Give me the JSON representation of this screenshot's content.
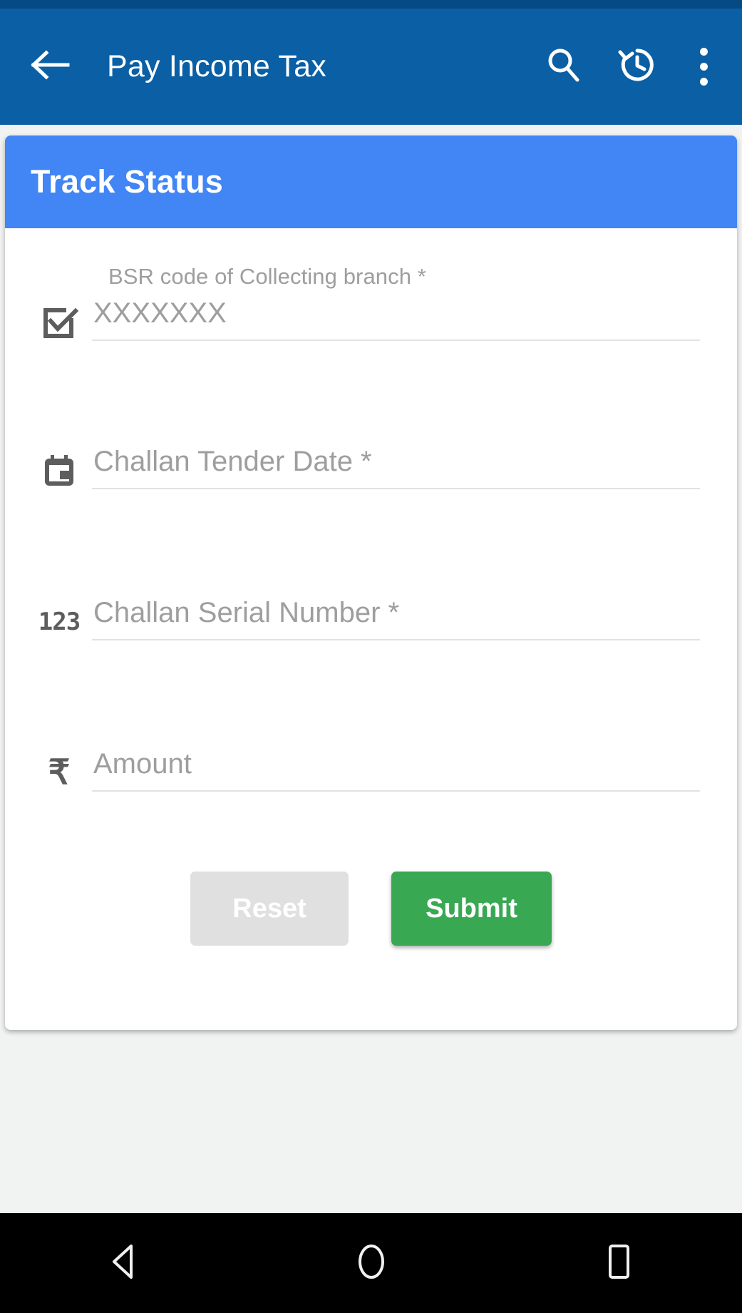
{
  "appbar": {
    "title": "Pay Income Tax",
    "back_icon": "arrow-left-icon",
    "search_icon": "search-icon",
    "history_icon": "history-icon",
    "overflow_icon": "more-vertical-icon"
  },
  "card": {
    "header_title": "Track Status",
    "fields": [
      {
        "id": "bsr-code",
        "label": "BSR code of Collecting branch *",
        "placeholder": "XXXXXXX",
        "value": "",
        "icon": "check-box-icon",
        "required": true
      },
      {
        "id": "challan-tender-date",
        "label": "",
        "placeholder": "Challan Tender Date *",
        "value": "",
        "icon": "calendar-icon",
        "required": true
      },
      {
        "id": "challan-serial-number",
        "label": "",
        "placeholder": "Challan Serial Number *",
        "value": "",
        "icon": "numeric-123-icon",
        "icon_text": "123",
        "required": true
      },
      {
        "id": "amount",
        "label": "",
        "placeholder": "Amount",
        "value": "",
        "icon": "rupee-icon",
        "icon_text": "₹",
        "required": false
      }
    ],
    "reset_label": "Reset",
    "submit_label": "Submit"
  },
  "navbar": {
    "back_label": "back-triangle-icon",
    "home_label": "home-circle-icon",
    "recents_label": "recents-square-icon"
  },
  "colors": {
    "appbar": "#0a5fa5",
    "status_strip": "#054a82",
    "card_header": "#4285f4",
    "submit": "#38a852",
    "reset": "#e0e0e0",
    "page_background": "#f1f2f2",
    "navbar": "#000000",
    "placeholder_text": "#9e9e9e",
    "icon_gray": "#5d5d5d"
  }
}
